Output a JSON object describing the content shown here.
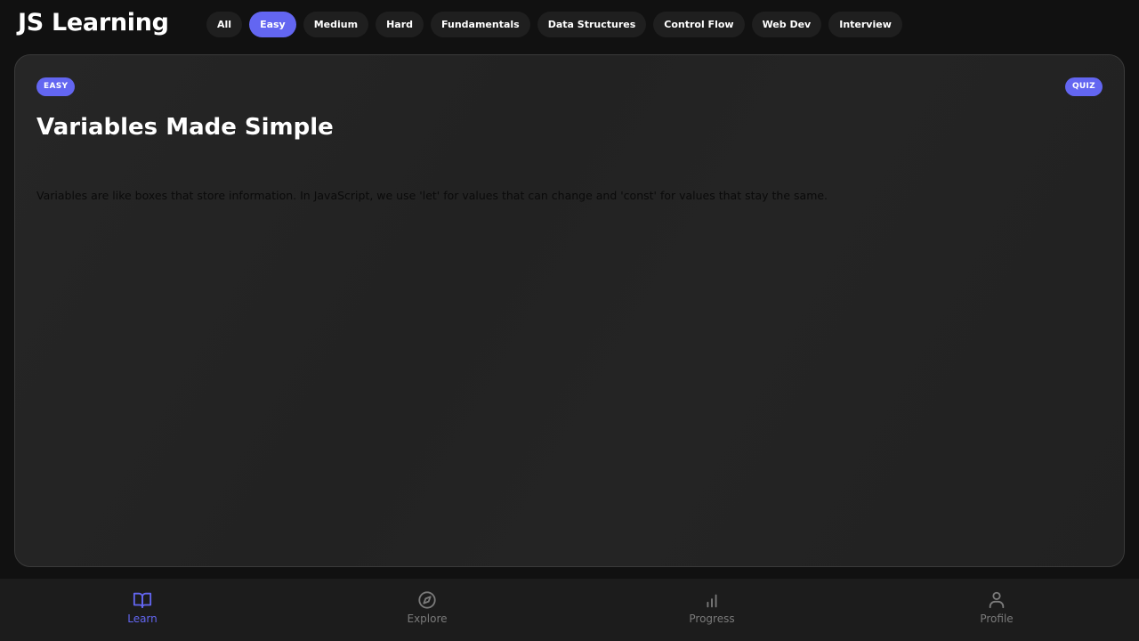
{
  "app": {
    "title": "JS Learning"
  },
  "filters": [
    {
      "label": "All",
      "active": false
    },
    {
      "label": "Easy",
      "active": true
    },
    {
      "label": "Medium",
      "active": false
    },
    {
      "label": "Hard",
      "active": false
    },
    {
      "label": "Fundamentals",
      "active": false
    },
    {
      "label": "Data Structures",
      "active": false
    },
    {
      "label": "Control Flow",
      "active": false
    },
    {
      "label": "Web Dev",
      "active": false
    },
    {
      "label": "Interview",
      "active": false
    }
  ],
  "card": {
    "difficulty": "EASY",
    "type": "QUIZ",
    "title": "Variables Made Simple",
    "body": "Variables are like boxes that store information. In JavaScript, we use 'let' for values that can change and 'const' for values that stay the same."
  },
  "nav": [
    {
      "label": "Learn",
      "icon": "book-icon",
      "active": true
    },
    {
      "label": "Explore",
      "icon": "compass-icon",
      "active": false
    },
    {
      "label": "Progress",
      "icon": "bar-chart-icon",
      "active": false
    },
    {
      "label": "Profile",
      "icon": "user-icon",
      "active": false
    }
  ],
  "colors": {
    "accent": "#6366f1",
    "background": "#111111",
    "card": "#242424",
    "nav_bg": "#1c1c1c",
    "nav_inactive": "#7a7a7a"
  }
}
